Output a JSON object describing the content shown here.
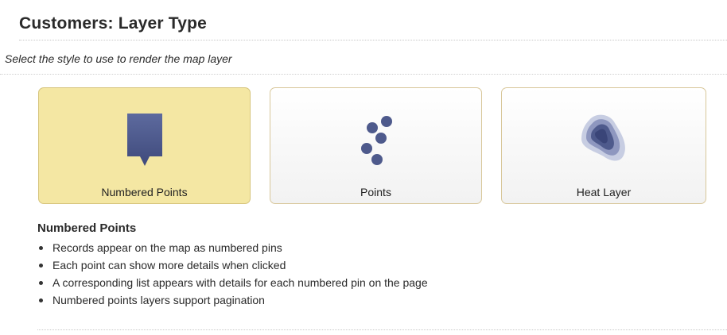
{
  "header": {
    "title": "Customers: Layer Type",
    "subtitle": "Select the style to use to render the map layer"
  },
  "options": [
    {
      "label": "Numbered Points",
      "icon": "numbered-pin-icon",
      "selected": true
    },
    {
      "label": "Points",
      "icon": "points-cluster-icon",
      "selected": false
    },
    {
      "label": "Heat Layer",
      "icon": "heat-layer-icon",
      "selected": false
    }
  ],
  "description": {
    "title": "Numbered Points",
    "bullets": [
      "Records appear on the map as numbered pins",
      "Each point can show more details when clicked",
      "A corresponding list appears with details for each numbered pin on the page",
      "Numbered points layers support pagination"
    ]
  },
  "colors": {
    "selected_card": "#f4e7a3",
    "card_border": "#d8c79a",
    "icon_fill": "#4e5a8c"
  }
}
